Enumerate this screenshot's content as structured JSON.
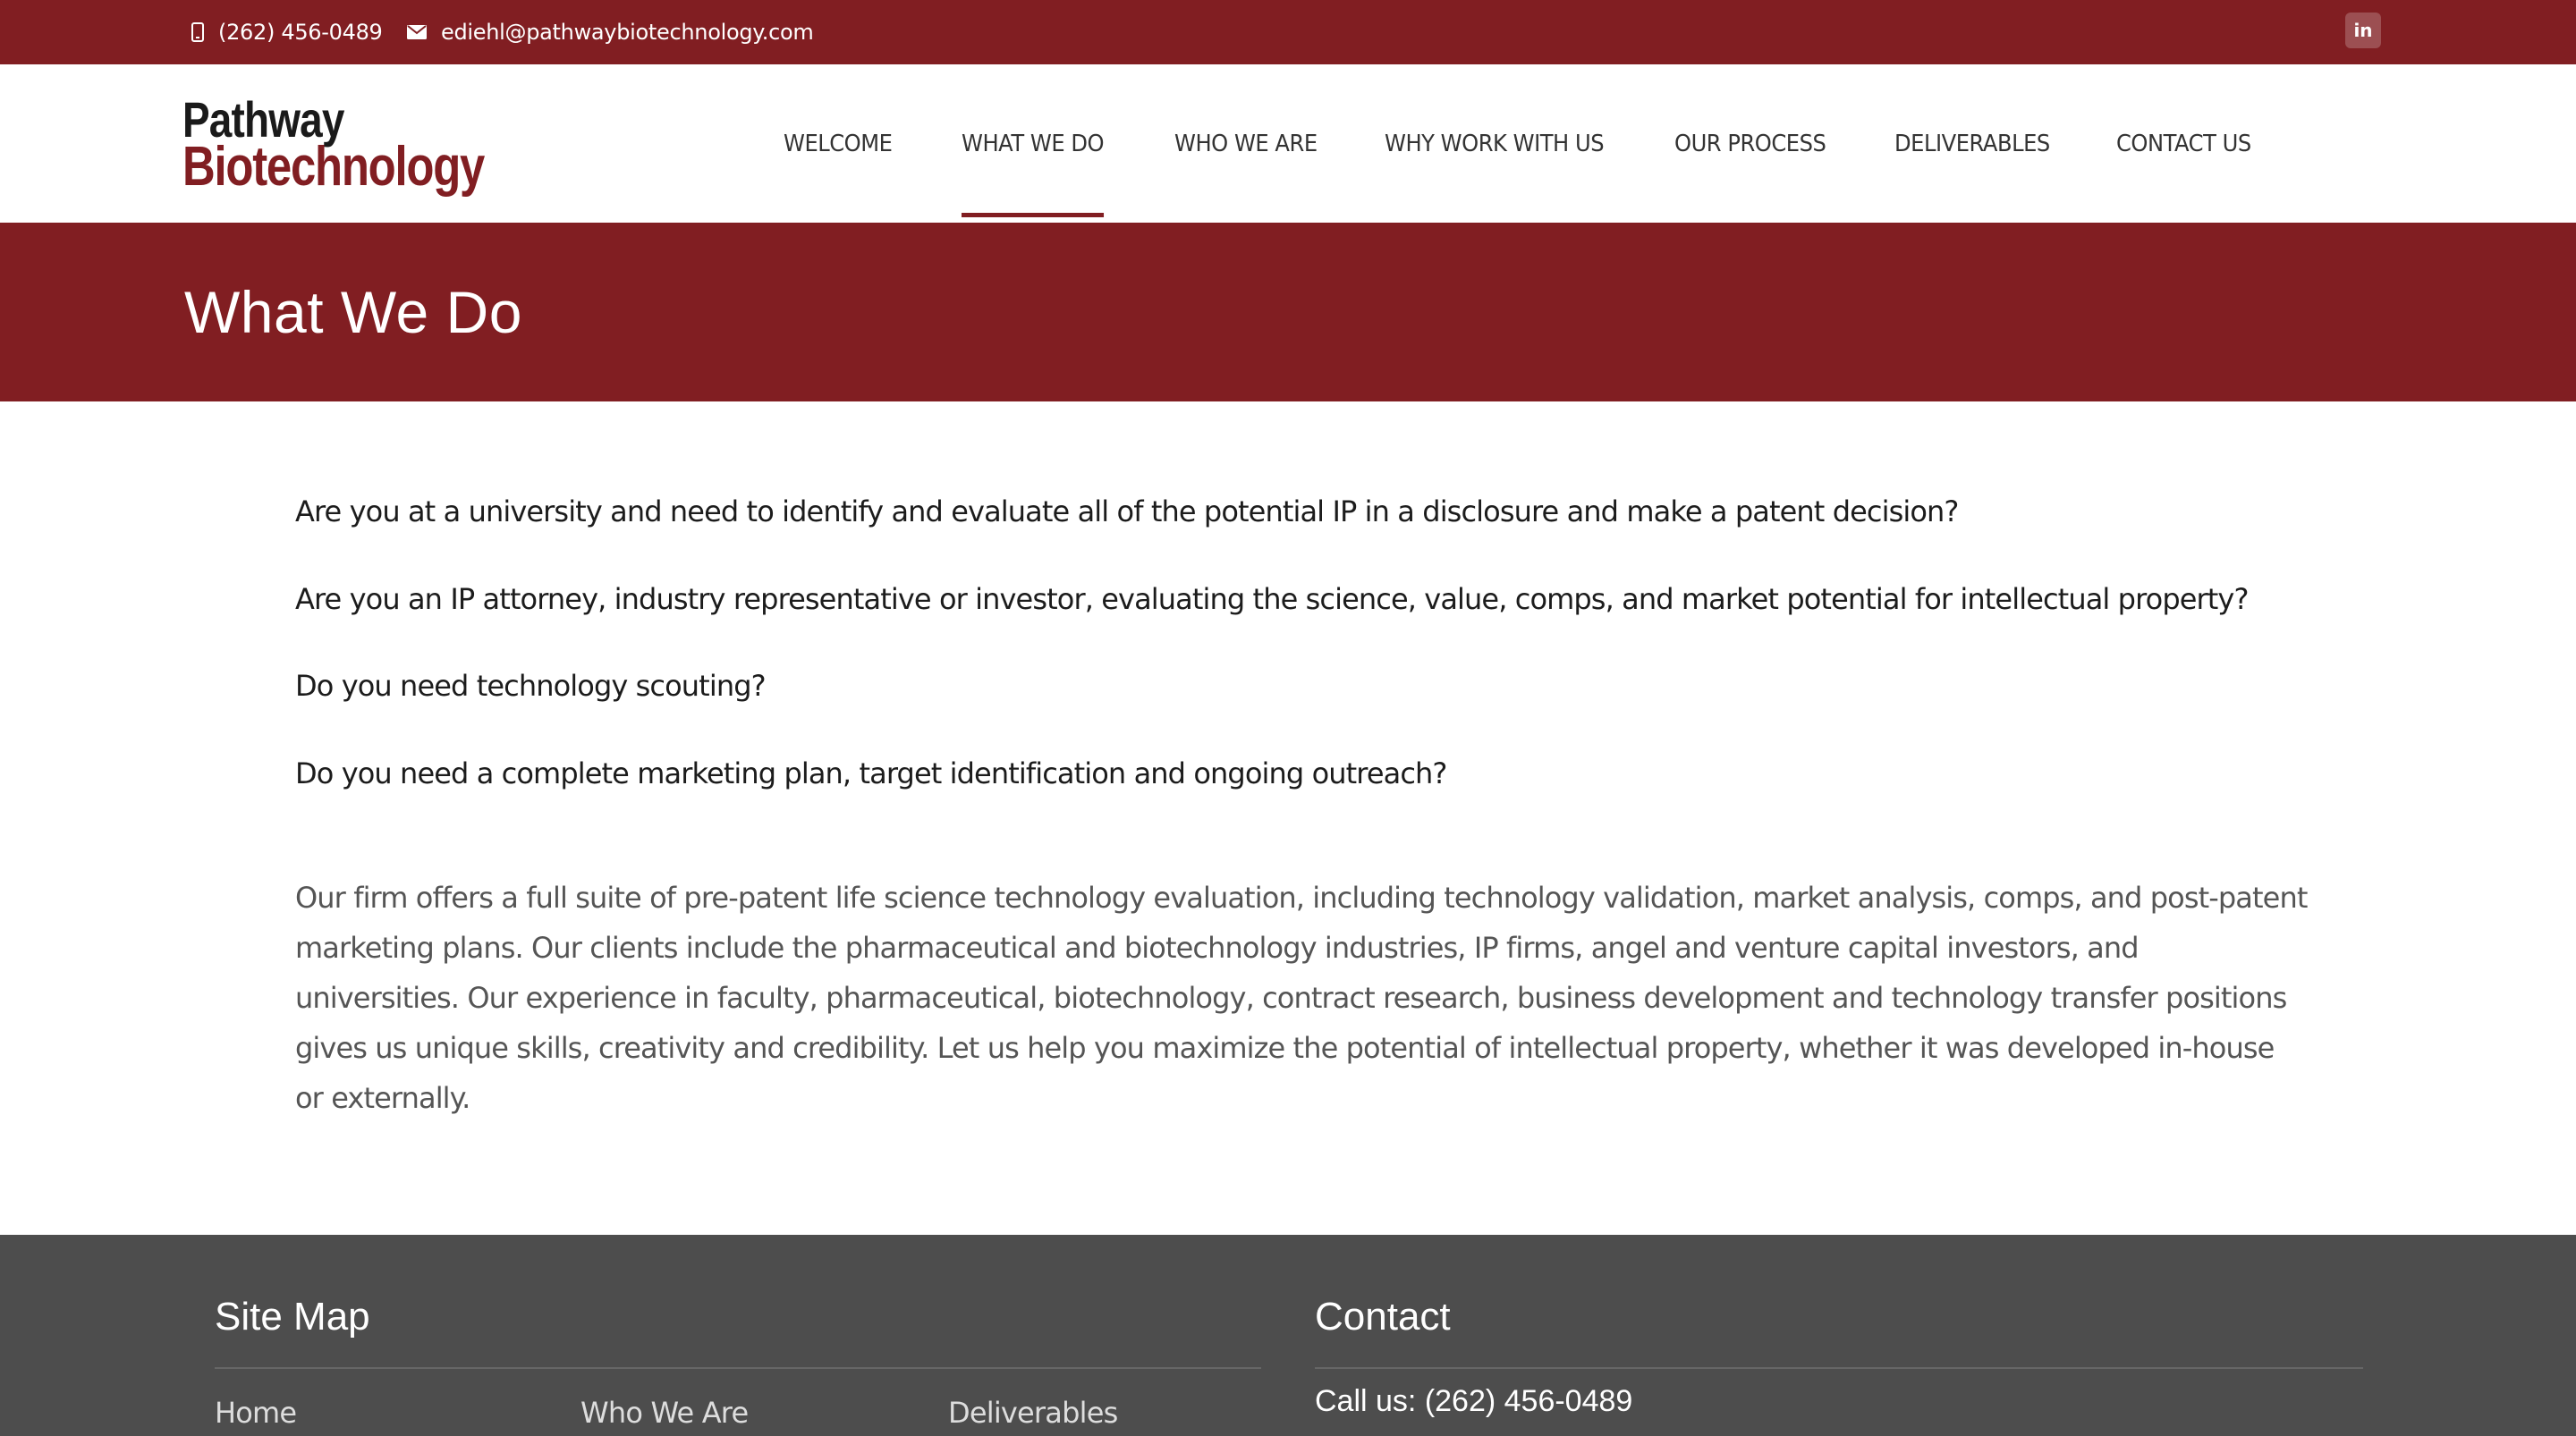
{
  "topbar": {
    "phone": "(262) 456-0489",
    "email": "ediehl@pathwaybiotechnology.com",
    "social": "in",
    "phone_icon": "phone-icon",
    "email_icon": "envelope-icon",
    "social_icon": "linkedin-icon"
  },
  "logo": {
    "line1": "Pathway",
    "line2": "Biotechnology"
  },
  "nav": {
    "items": [
      {
        "label": "WELCOME"
      },
      {
        "label": "WHAT WE DO",
        "active": true
      },
      {
        "label": "WHO WE ARE"
      },
      {
        "label": "WHY WORK WITH US"
      },
      {
        "label": "OUR PROCESS"
      },
      {
        "label": "DELIVERABLES"
      },
      {
        "label": "CONTACT US"
      }
    ]
  },
  "page": {
    "title": "What We Do"
  },
  "content": {
    "questions": [
      "Are you at a university and need to identify and evaluate all of the potential IP in a disclosure and make a patent decision?",
      "Are you an IP attorney, industry representative or investor, evaluating the science, value, comps, and market potential for intellectual property?",
      "Do you need technology scouting?",
      "Do you need a complete marketing plan, target identification and ongoing outreach?"
    ],
    "description": "Our firm offers a full suite of pre-patent life science technology evaluation, including technology validation, market analysis, comps, and post-patent marketing plans. Our clients include the pharmaceutical and biotechnology industries, IP firms, angel and venture capital investors, and universities. Our experience in faculty, pharmaceutical, biotechnology, contract research, business development and technology transfer positions gives us unique skills, creativity and credibility. Let us help you maximize the potential of intellectual property, whether it was developed in-house or externally."
  },
  "footer": {
    "sitemap_title": "Site Map",
    "contact_title": "Contact",
    "links": [
      "Home",
      "Who We Are",
      "Deliverables"
    ],
    "call": "Call us: (262) 456-0489"
  },
  "colors": {
    "brand": "#811e22",
    "footer_bg": "#4d4d4d",
    "text": "#333333"
  }
}
